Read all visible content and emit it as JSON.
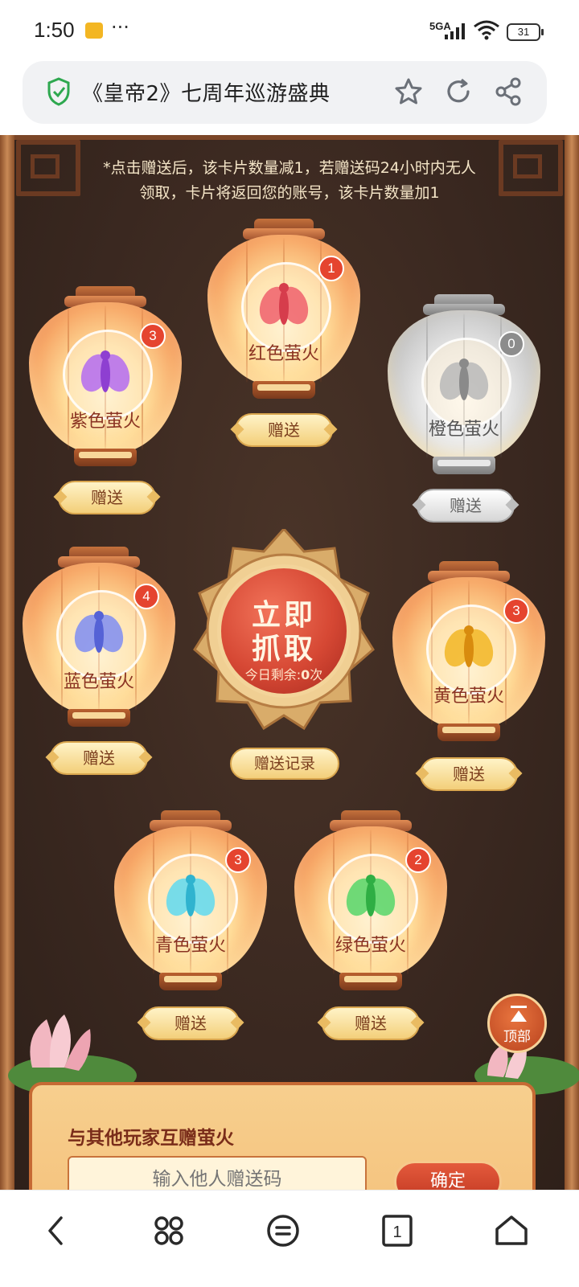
{
  "status_bar": {
    "time": "1:50",
    "network": "5GA",
    "battery": "31"
  },
  "browser": {
    "page_title": "《皇帝2》七周年巡游盛典"
  },
  "notice": {
    "line1": "*点击赠送后，该卡片数量减1，若赠送码24小时内无人",
    "line2": "领取，卡片将返回您的账号，该卡片数量加1"
  },
  "lanterns": [
    {
      "name": "紫色萤火",
      "count": "3",
      "color": "#b46bf0",
      "active": true
    },
    {
      "name": "红色萤火",
      "count": "1",
      "color": "#f0606c",
      "active": true
    },
    {
      "name": "橙色萤火",
      "count": "0",
      "color": "#9a9a9a",
      "active": false
    },
    {
      "name": "蓝色萤火",
      "count": "4",
      "color": "#7f8df2",
      "active": true
    },
    {
      "name": "黄色萤火",
      "count": "3",
      "color": "#f2b624",
      "active": true
    },
    {
      "name": "青色萤火",
      "count": "3",
      "color": "#5fd9f0",
      "active": true
    },
    {
      "name": "绿色萤火",
      "count": "2",
      "color": "#56d66a",
      "active": true
    }
  ],
  "gift_label": "赠送",
  "catch_button": {
    "line1": "立即",
    "line2": "抓取",
    "remaining_label": "今日剩余:",
    "remaining_value": "0",
    "remaining_unit": "次"
  },
  "gift_record": "赠送记录",
  "top_button": "顶部",
  "exchange": {
    "title": "与其他玩家互赠萤火",
    "placeholder": "输入他人赠送码",
    "confirm": "确定"
  }
}
